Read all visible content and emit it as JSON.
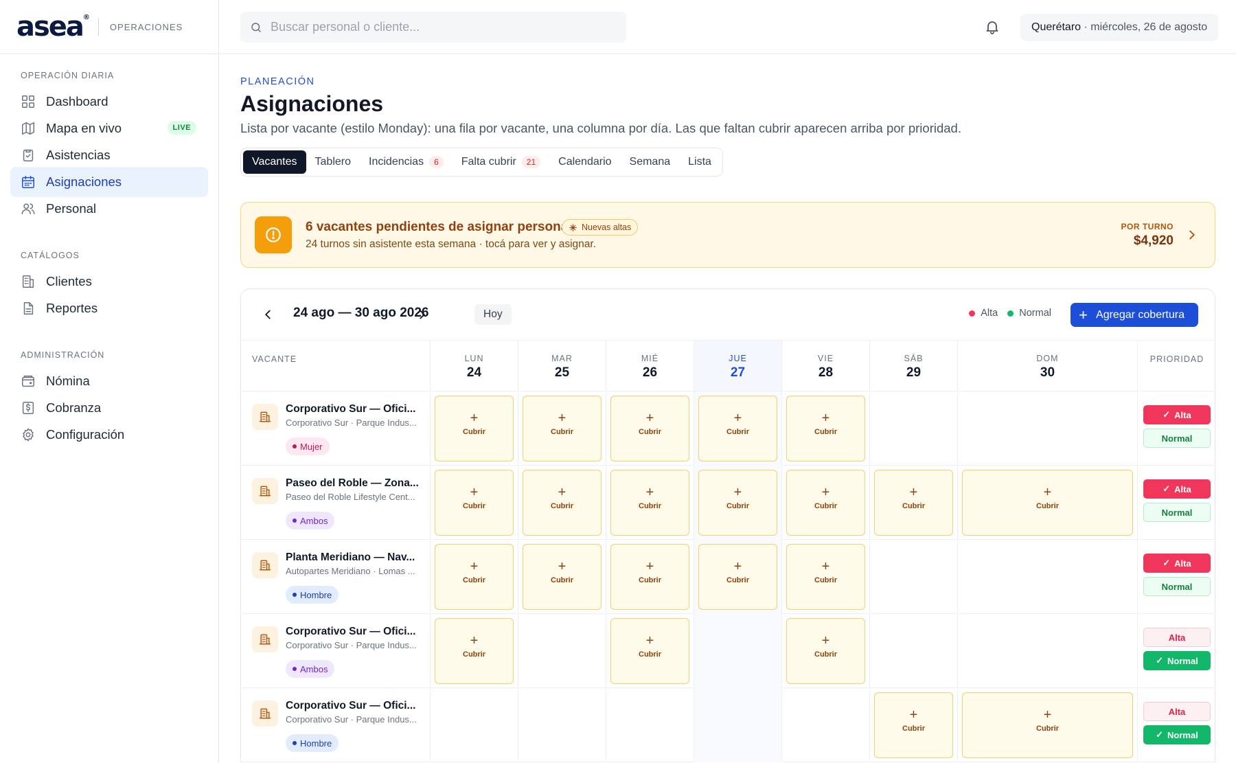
{
  "brand": {
    "logo": "asea",
    "reg": "®",
    "section": "OPERACIONES"
  },
  "sidebar": {
    "sections": [
      {
        "title": "OPERACIÓN DIARIA",
        "items": [
          {
            "label": "Dashboard",
            "icon": "dashboard-icon"
          },
          {
            "label": "Mapa en vivo",
            "icon": "map-icon",
            "badge": "LIVE"
          },
          {
            "label": "Asistencias",
            "icon": "clipboard-icon"
          },
          {
            "label": "Asignaciones",
            "icon": "calendar-icon",
            "active": true
          },
          {
            "label": "Personal",
            "icon": "users-icon"
          }
        ]
      },
      {
        "title": "CATÁLOGOS",
        "items": [
          {
            "label": "Clientes",
            "icon": "building-icon"
          },
          {
            "label": "Reportes",
            "icon": "document-icon"
          }
        ]
      },
      {
        "title": "ADMINISTRACIÓN",
        "items": [
          {
            "label": "Nómina",
            "icon": "wallet-icon"
          },
          {
            "label": "Cobranza",
            "icon": "dollar-receipt-icon"
          },
          {
            "label": "Configuración",
            "icon": "gear-icon"
          }
        ]
      }
    ]
  },
  "header": {
    "search_placeholder": "Buscar personal o cliente...",
    "city": "Querétaro",
    "date": "· miércoles, 26 de agosto"
  },
  "page": {
    "eyebrow": "PLANEACIÓN",
    "title": "Asignaciones",
    "subtitle": "Lista por vacante (estilo Monday): una fila por vacante, una columna por día. Las que faltan cubrir aparecen arriba por prioridad."
  },
  "tabs": [
    {
      "label": "Vacantes",
      "active": true
    },
    {
      "label": "Tablero"
    },
    {
      "label": "Incidencias",
      "count": "6"
    },
    {
      "label": "Falta cubrir",
      "count": "21"
    },
    {
      "label": "Calendario"
    },
    {
      "label": "Semana"
    },
    {
      "label": "Lista"
    }
  ],
  "alert": {
    "title": "6 vacantes pendientes de asignar personal",
    "chip": "Nuevas altas",
    "subtitle": "24 turnos sin asistente esta semana · tocá para ver y asignar.",
    "right_label": "POR TURNO",
    "right_amount": "$4,920"
  },
  "calendar": {
    "range": "24 ago — 30 ago 2026",
    "today_button": "Hoy",
    "legend": [
      {
        "label": "Alta",
        "color": "#f0375b"
      },
      {
        "label": "Normal",
        "color": "#12b76a"
      }
    ],
    "add_button": "Agregar cobertura",
    "col_vacante": "VACANTE",
    "col_prioridad": "PRIORIDAD",
    "days": [
      {
        "dow": "LUN",
        "num": "24"
      },
      {
        "dow": "MAR",
        "num": "25"
      },
      {
        "dow": "MIÉ",
        "num": "26"
      },
      {
        "dow": "JUE",
        "num": "27",
        "today": true
      },
      {
        "dow": "VIE",
        "num": "28"
      },
      {
        "dow": "SÁB",
        "num": "29"
      },
      {
        "dow": "DOM",
        "num": "30"
      }
    ],
    "cell_label": "Cubrir",
    "priority_labels": {
      "alta": "Alta",
      "normal": "Normal"
    },
    "rows": [
      {
        "name": "Corporativo Sur — Ofici...",
        "location": "Corporativo Sur · Parque Indus...",
        "gender": "Mujer",
        "gender_class": "g-mujer",
        "open": [
          true,
          true,
          true,
          true,
          true,
          false,
          false
        ],
        "priority": "alta"
      },
      {
        "name": "Paseo del Roble — Zona...",
        "location": "Paseo del Roble Lifestyle Cent...",
        "gender": "Ambos",
        "gender_class": "g-ambos",
        "open": [
          true,
          true,
          true,
          true,
          true,
          true,
          true
        ],
        "priority": "alta"
      },
      {
        "name": "Planta Meridiano — Nav...",
        "location": "Autopartes Meridiano · Lomas ...",
        "gender": "Hombre",
        "gender_class": "g-hombre",
        "open": [
          true,
          true,
          true,
          true,
          true,
          false,
          false
        ],
        "priority": "alta"
      },
      {
        "name": "Corporativo Sur — Ofici...",
        "location": "Corporativo Sur · Parque Indus...",
        "gender": "Ambos",
        "gender_class": "g-ambos",
        "open": [
          true,
          false,
          true,
          false,
          true,
          false,
          false
        ],
        "priority": "normal"
      },
      {
        "name": "Corporativo Sur — Ofici...",
        "location": "Corporativo Sur · Parque Indus...",
        "gender": "Hombre",
        "gender_class": "g-hombre",
        "open": [
          false,
          false,
          false,
          false,
          false,
          true,
          true
        ],
        "priority": "normal"
      }
    ]
  }
}
